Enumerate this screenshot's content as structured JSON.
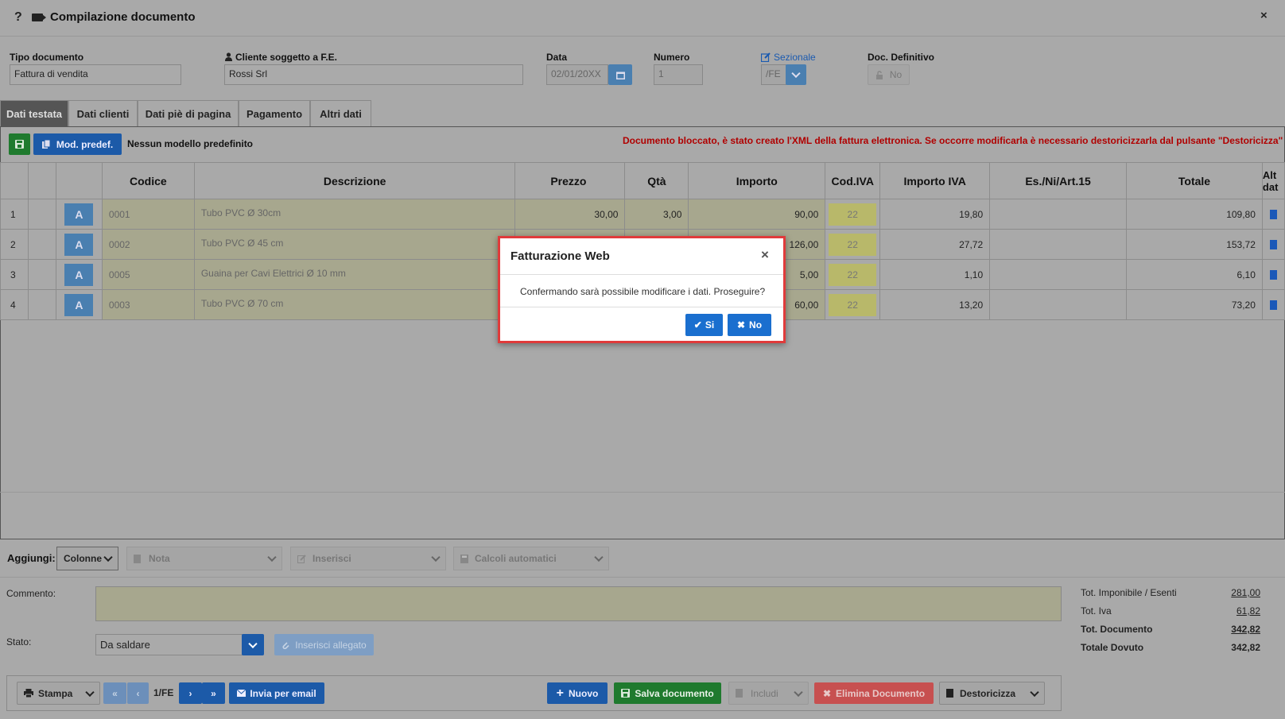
{
  "window": {
    "help": "?",
    "title": "Compilazione documento",
    "close": "×"
  },
  "fields": {
    "tipo_label": "Tipo documento",
    "tipo_value": "Fattura di vendita",
    "cliente_label": "Cliente soggetto a F.E.",
    "cliente_value": "Rossi Srl",
    "data_label": "Data",
    "data_value": "02/01/20XX",
    "numero_label": "Numero",
    "numero_value": "1",
    "sezionale_label": "Sezionale",
    "sezionale_value": "/FE",
    "definitivo_label": "Doc. Definitivo",
    "definitivo_value": "No"
  },
  "tabs": [
    "Dati testata",
    "Dati clienti",
    "Dati piè di pagina",
    "Pagamento",
    "Altri dati"
  ],
  "toolbar": {
    "model_button": "Mod. predef.",
    "model_text": "Nessun modello predefinito",
    "warning": "Documento bloccato, è stato creato l'XML della fattura elettronica. Se occorre modificarla è necessario destoricizzarla dal pulsante \"Destoricizza\""
  },
  "table": {
    "headers": [
      "",
      "",
      "",
      "Codice",
      "Descrizione",
      "Prezzo",
      "Qtà",
      "Importo",
      "Cod.IVA",
      "Importo IVA",
      "Es./Ni/Art.15",
      "Totale",
      "Alt dat"
    ],
    "rows": [
      {
        "n": "1",
        "a": "A",
        "codice": "0001",
        "descrizione": "Tubo PVC Ø 30cm",
        "prezzo": "30,00",
        "qta": "3,00",
        "importo": "90,00",
        "iva": "22",
        "importo_iva": "19,80",
        "es": "",
        "totale": "109,80"
      },
      {
        "n": "2",
        "a": "A",
        "codice": "0002",
        "descrizione": "Tubo PVC Ø 45 cm",
        "prezzo": "",
        "qta": "",
        "importo": "126,00",
        "iva": "22",
        "importo_iva": "27,72",
        "es": "",
        "totale": "153,72"
      },
      {
        "n": "3",
        "a": "A",
        "codice": "0005",
        "descrizione": "Guaina per Cavi Elettrici Ø 10 mm",
        "prezzo": "",
        "qta": "",
        "importo": "5,00",
        "iva": "22",
        "importo_iva": "1,10",
        "es": "",
        "totale": "6,10"
      },
      {
        "n": "4",
        "a": "A",
        "codice": "0003",
        "descrizione": "Tubo PVC Ø 70 cm",
        "prezzo": "",
        "qta": "",
        "importo": "60,00",
        "iva": "22",
        "importo_iva": "13,20",
        "es": "",
        "totale": "73,20"
      }
    ]
  },
  "aggiungi": {
    "label": "Aggiungi:",
    "colonne": "Colonne",
    "nota": "Nota",
    "inserisci": "Inserisci",
    "calcoli": "Calcoli automatici"
  },
  "footer": {
    "commento_label": "Commento:",
    "stato_label": "Stato:",
    "stato_value": "Da saldare",
    "allegato": "Inserisci allegato"
  },
  "totals": [
    {
      "label": "Tot. Imponibile / Esenti",
      "value": "281,00"
    },
    {
      "label": "Tot. Iva",
      "value": "61,82"
    },
    {
      "label": "Tot. Documento",
      "value": "342,82"
    },
    {
      "label": "Totale Dovuto",
      "value": "342,82"
    }
  ],
  "bottom": {
    "stampa": "Stampa",
    "page": "1/FE",
    "email": "Invia per email",
    "nuovo": "Nuovo",
    "salva": "Salva documento",
    "includi": "Includi",
    "elimina": "Elimina Documento",
    "destoricizza": "Destoricizza"
  },
  "modal": {
    "title": "Fatturazione Web",
    "close": "×",
    "message": "Confermando sarà possibile modificare i dati. Proseguire?",
    "yes": "Si",
    "no": "No"
  },
  "colors": {
    "accent": "#1a6fcf",
    "highlight_border": "#e03b3b",
    "warning": "#b00000"
  }
}
